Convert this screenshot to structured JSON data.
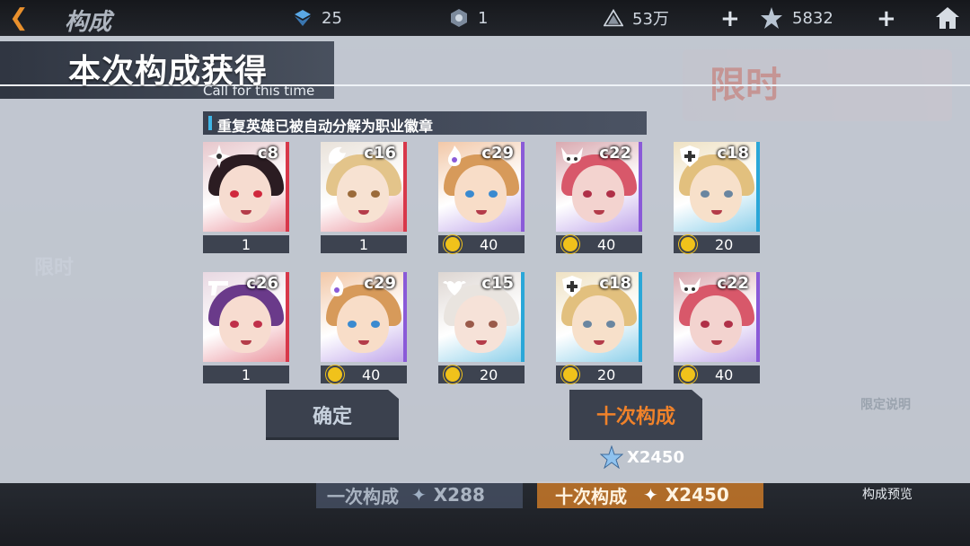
{
  "topbar": {
    "back_icon": "back-arrow-icon",
    "title": "构成",
    "resources": [
      {
        "icon": "blue-cube-icon",
        "value": "25"
      },
      {
        "icon": "hex-token-icon",
        "value": "1"
      },
      {
        "icon": "triangle-emblem-icon",
        "value": "53万"
      },
      {
        "icon": "star-crystal-icon",
        "value": "5832"
      }
    ],
    "home_icon": "home-icon"
  },
  "modal": {
    "title": "本次构成获得",
    "subtitle": "Call for this time",
    "notice": "重复英雄已被自动分解为职业徽章",
    "heroes": [
      {
        "code": "c8",
        "count": "1",
        "badge": false,
        "emblem": "shuriken-icon",
        "accent": "#d8384a",
        "hair": "#2b1c22",
        "skin": "#f6dcd0",
        "eye": "#d0283c",
        "bg": "#e7c7cc"
      },
      {
        "code": "c16",
        "count": "1",
        "badge": false,
        "emblem": "dragon-icon",
        "accent": "#d8384a",
        "hair": "#e3c48a",
        "skin": "#f7e2d2",
        "eye": "#9b6b3a",
        "bg": "#e9e2da"
      },
      {
        "code": "c29",
        "count": "40",
        "badge": true,
        "emblem": "flame-icon",
        "accent": "#8a5ad8",
        "hair": "#d79a5a",
        "skin": "#f8ddc8",
        "eye": "#3a8ad0",
        "bg": "#f2c8a8"
      },
      {
        "code": "c22",
        "count": "40",
        "badge": true,
        "emblem": "horned-mask-icon",
        "accent": "#8a5ad8",
        "hair": "#d8586a",
        "skin": "#f3d3cf",
        "eye": "#b03048",
        "bg": "#d9a9b0"
      },
      {
        "code": "c18",
        "count": "20",
        "badge": true,
        "emblem": "shield-cross-icon",
        "accent": "#2aa7d8",
        "hair": "#e2c07e",
        "skin": "#f7e0ca",
        "eye": "#6a86a0",
        "bg": "#efe2c4"
      },
      {
        "code": "c26",
        "count": "1",
        "badge": false,
        "emblem": "pistol-icon",
        "accent": "#d8384a",
        "hair": "#6a3a8a",
        "skin": "#f7dcd0",
        "eye": "#c0304a",
        "bg": "#e8d8e2"
      },
      {
        "code": "c29",
        "count": "40",
        "badge": true,
        "emblem": "flame-icon",
        "accent": "#8a5ad8",
        "hair": "#d79a5a",
        "skin": "#f8ddc8",
        "eye": "#3a8ad0",
        "bg": "#f2c8a8"
      },
      {
        "code": "c15",
        "count": "20",
        "badge": true,
        "emblem": "heart-wings-icon",
        "accent": "#2aa7d8",
        "hair": "#e9e4df",
        "skin": "#f6e2d8",
        "eye": "#9a5a4a",
        "bg": "#ddd6d2"
      },
      {
        "code": "c18",
        "count": "20",
        "badge": true,
        "emblem": "shield-cross-icon",
        "accent": "#2aa7d8",
        "hair": "#e2c07e",
        "skin": "#f7e0ca",
        "eye": "#6a86a0",
        "bg": "#efe2c4"
      },
      {
        "code": "c22",
        "count": "40",
        "badge": true,
        "emblem": "horned-mask-icon",
        "accent": "#8a5ad8",
        "hair": "#d8586a",
        "skin": "#f3d3cf",
        "eye": "#b03048",
        "bg": "#d9a9b0"
      }
    ],
    "confirm_label": "确定",
    "ten_label": "十次构成",
    "ten_cost": "X2450"
  },
  "background": {
    "limited_banner": "限时",
    "limited_side": "限时",
    "rule_label": "限定说明",
    "preview_label": "构成预览",
    "one_pull": {
      "label": "一次构成",
      "cost": "X288"
    },
    "ten_pull": {
      "label": "十次构成",
      "cost": "X2450"
    }
  }
}
